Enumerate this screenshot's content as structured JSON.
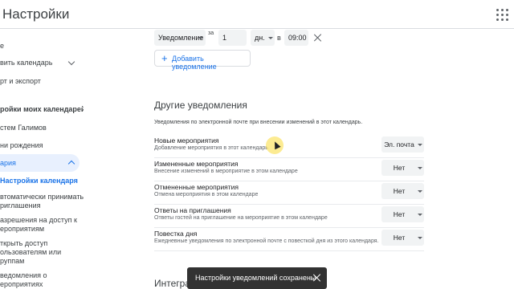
{
  "header": {
    "title": "Настройки"
  },
  "sidebar": {
    "items": [
      {
        "label": "е"
      },
      {
        "label": "вить календарь"
      },
      {
        "label": "рт и экспорт"
      },
      {
        "label": "ройки моих календарей"
      },
      {
        "label": "стем Галимов"
      },
      {
        "label": "ни рождения"
      },
      {
        "label": "ария"
      }
    ],
    "sub_items": [
      {
        "label": "Настройки календаря"
      },
      {
        "label": "втоматически принимать",
        "label2": "риглашения"
      },
      {
        "label": "азрешения на доступ к",
        "label2": "ероприятиям"
      },
      {
        "label": "ткрыть доступ",
        "label2": "ользователям или",
        "label3": "руппам"
      },
      {
        "label": "ведомления о",
        "label2": "ероприятиях"
      }
    ]
  },
  "notification_row": {
    "type_value": "Уведомление",
    "in_label": "за",
    "amount_value": "1",
    "unit_value": "дн.",
    "at_label": "в",
    "time_value": "09:00"
  },
  "add_notification_label": "Добавить уведомление",
  "other_notifications": {
    "title": "Другие уведомления",
    "description": "Уведомления по электронной почте при внесении изменений в этот календарь.",
    "rows": [
      {
        "name": "Новые мероприятия",
        "desc": "Добавление мероприятия в этот календарь",
        "value": "Эл. почта"
      },
      {
        "name": "Измененные мероприятия",
        "desc": "Внесение изменений в мероприятие в этом календаре",
        "value": "Нет"
      },
      {
        "name": "Отмененные мероприятия",
        "desc": "Отмена мероприятия в этом календаре",
        "value": "Нет"
      },
      {
        "name": "Ответы на приглашения",
        "desc": "Ответы гостей на приглашение на мероприятие в этом календаре",
        "value": "Нет"
      },
      {
        "name": "Повестка дня",
        "desc": "Ежедневные уведомления по электронной почте с повесткой дня из этого календаря.",
        "value": "Нет"
      }
    ]
  },
  "next_section_title": "Интегра",
  "snackbar": {
    "message": "Настройки уведомлений сохранены"
  },
  "colors": {
    "accent": "#1a73e8",
    "active_bg": "#e8f0fe",
    "snackbar_bg": "#323232"
  }
}
